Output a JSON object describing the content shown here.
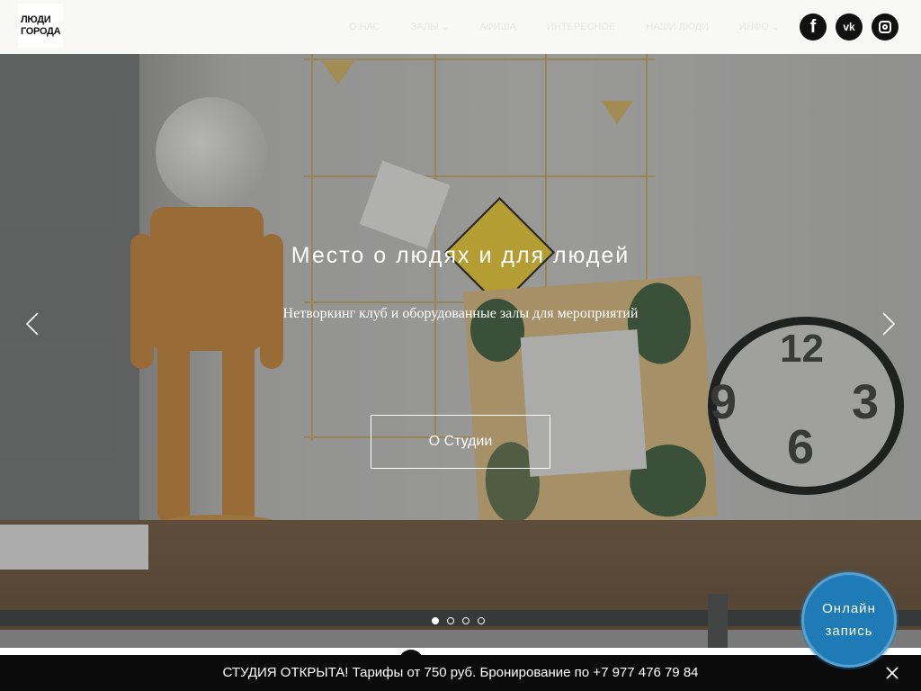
{
  "header": {
    "logo_line1": "ЛЮДИ",
    "logo_line2": "ГОРОДА",
    "nav": [
      {
        "label": "О НАС",
        "dropdown": false
      },
      {
        "label": "ЗАЛЫ",
        "dropdown": true
      },
      {
        "label": "АФИША",
        "dropdown": false
      },
      {
        "label": "ИНТЕРЕСНОЕ",
        "dropdown": false
      },
      {
        "label": "НАШИ ЛЮДИ",
        "dropdown": false
      },
      {
        "label": "ИНФО",
        "dropdown": true
      }
    ],
    "social": {
      "facebook": "f",
      "vk": "vk",
      "instagram": "instagram-icon"
    }
  },
  "hero": {
    "title": "Место о людях и для людей",
    "subtitle": "Нетворкинг клуб и оборудованные залы для мероприятий",
    "button_label": "О Студии",
    "slides_count": 4,
    "active_slide": 1
  },
  "online_booking": {
    "line1": "Онлайн",
    "line2": "запись"
  },
  "notice": {
    "text": "СТУДИЯ ОТКРЫТА! Тарифы от 750 руб. Бронирование по +7 977 476 79 84"
  },
  "colors": {
    "accent_blue": "#1e7bb6",
    "notice_bg": "#0b0b0b",
    "header_bg": "#f8f8f7"
  }
}
